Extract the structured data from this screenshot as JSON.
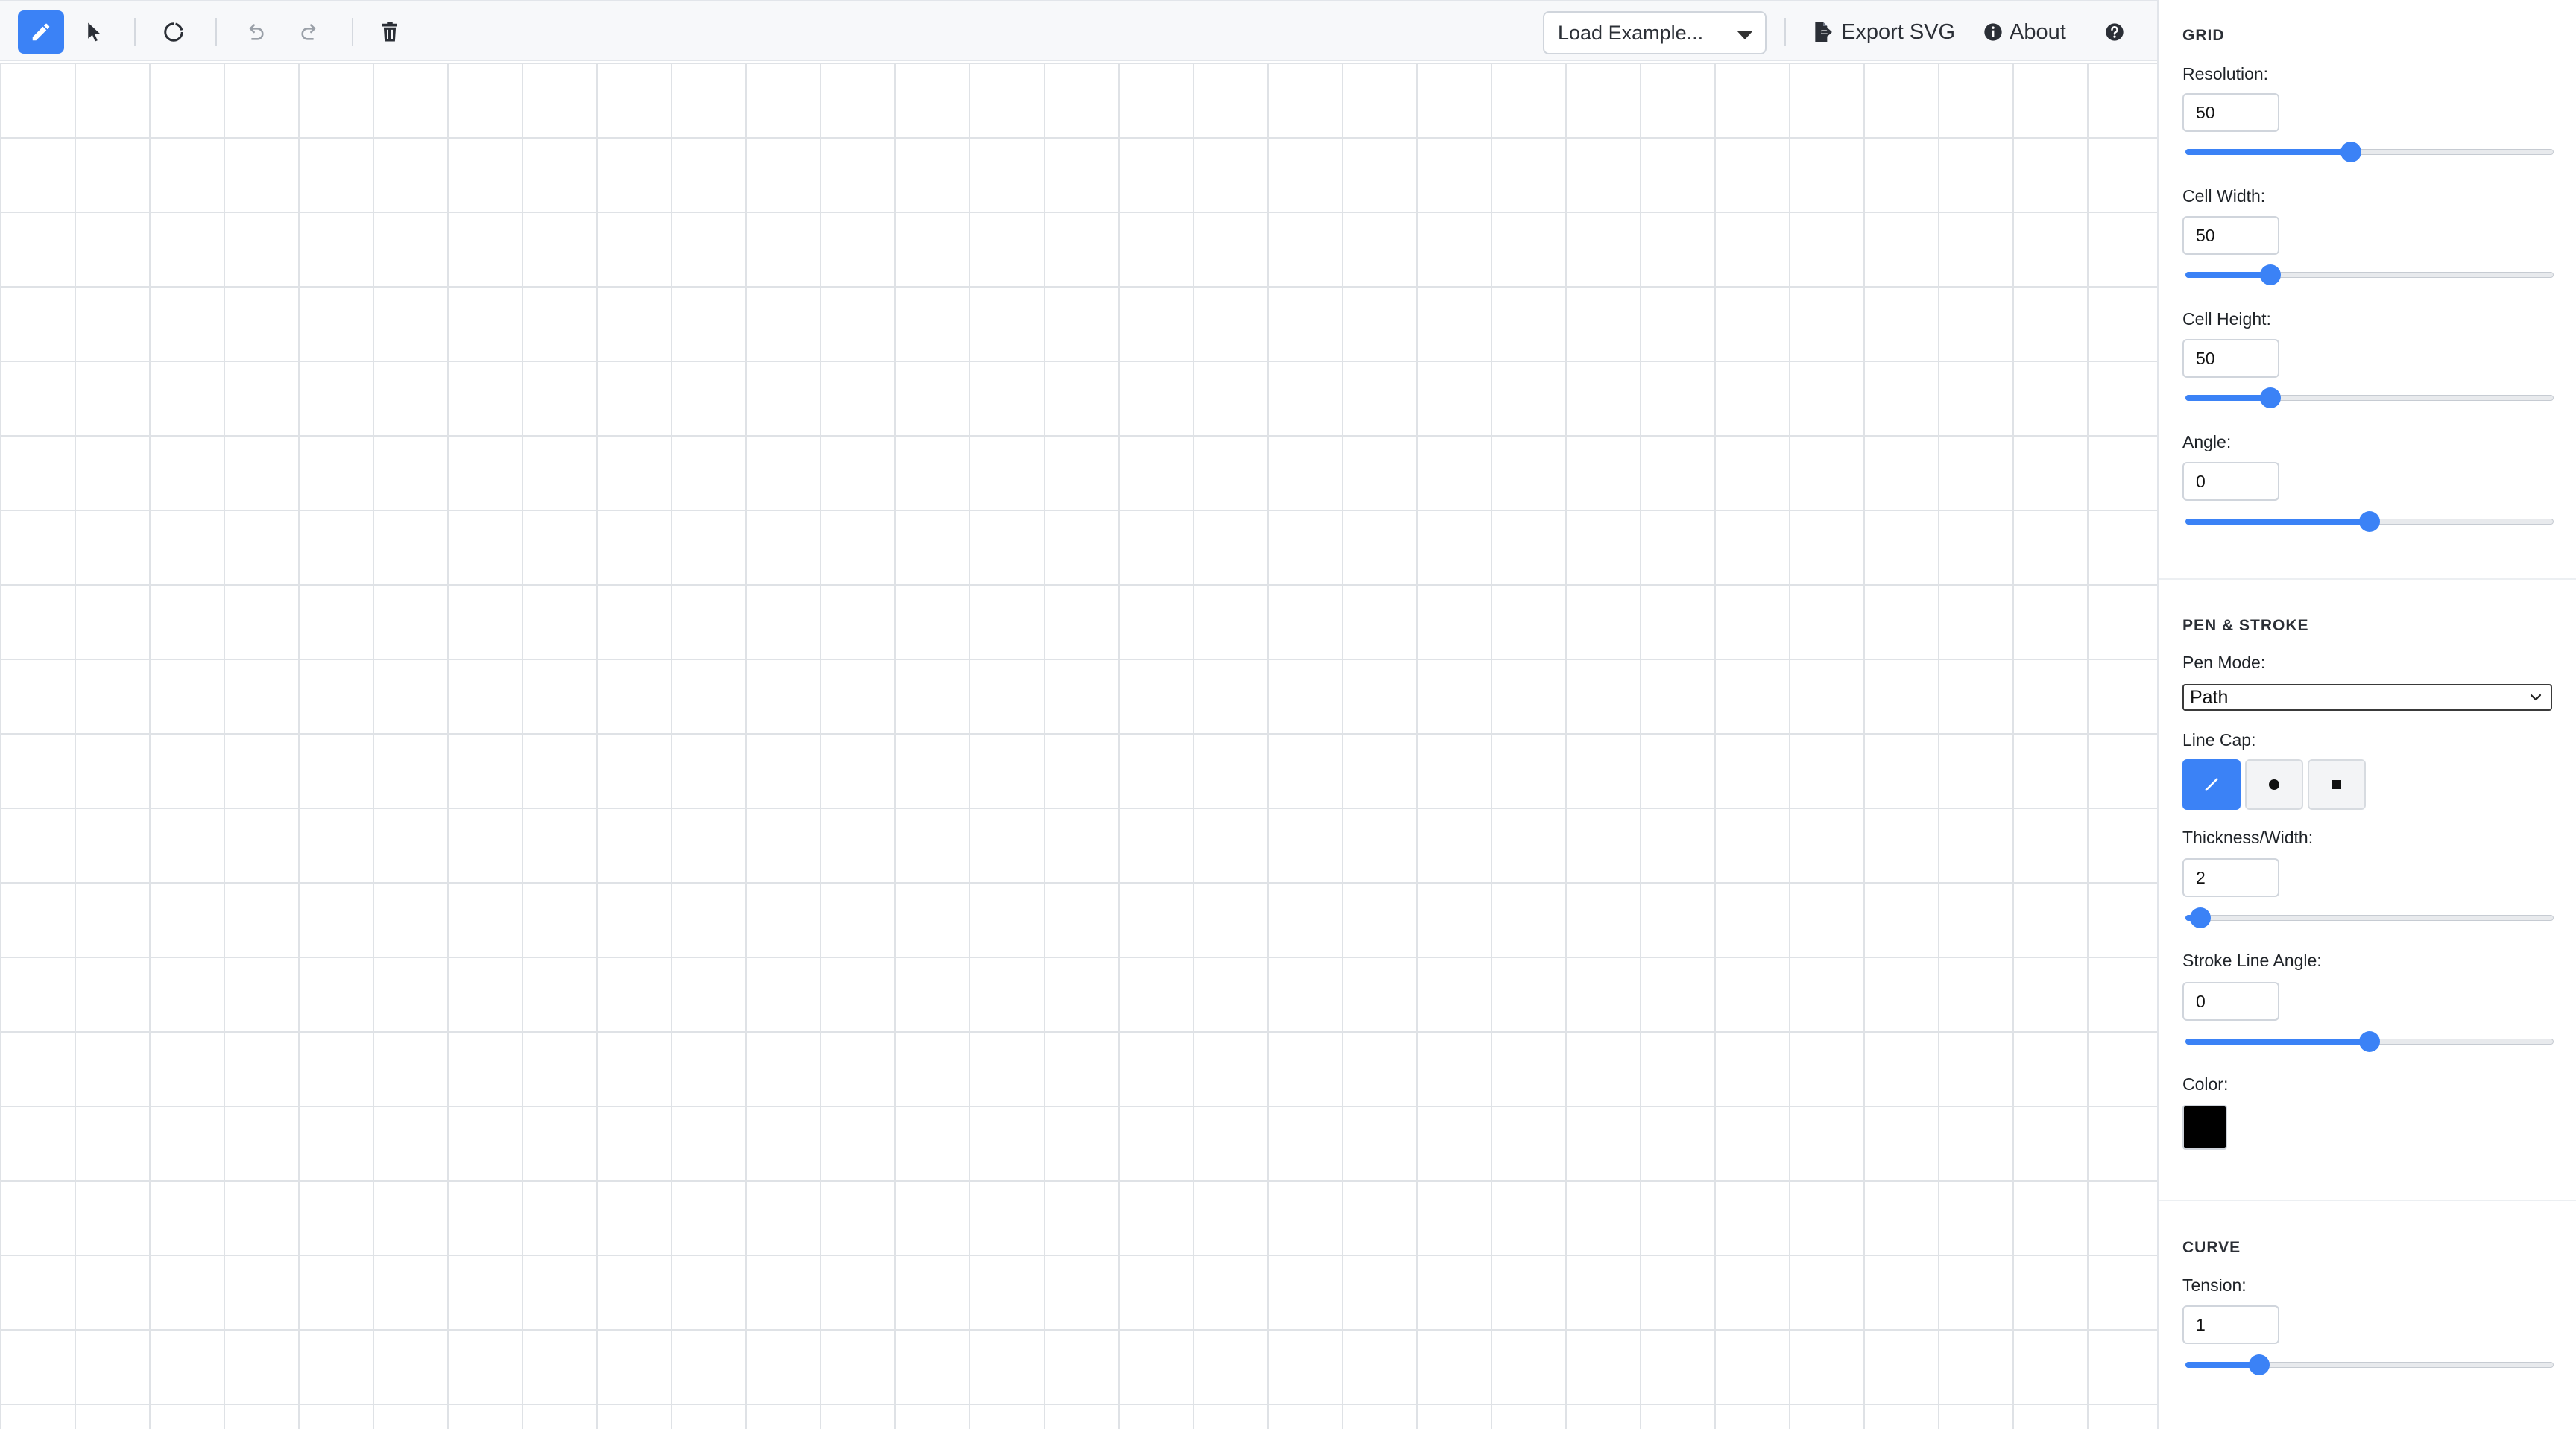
{
  "toolbar": {
    "tools": [
      {
        "name": "pencil-icon",
        "active": true
      },
      {
        "name": "pointer-icon",
        "active": false
      },
      {
        "name": "circle-icon",
        "active": false
      },
      {
        "name": "undo-icon",
        "active": false
      },
      {
        "name": "redo-icon",
        "active": false
      },
      {
        "name": "trash-icon",
        "active": false
      }
    ],
    "load_example_label": "Load Example...",
    "export_label": "Export SVG",
    "about_label": "About",
    "help_icon": "help-icon"
  },
  "sidebar": {
    "grid": {
      "title": "GRID",
      "resolution": {
        "label": "Resolution:",
        "value": "50",
        "level": 0.45
      },
      "cell_width": {
        "label": "Cell Width:",
        "value": "50",
        "level": 0.23
      },
      "cell_height": {
        "label": "Cell Height:",
        "value": "50",
        "level": 0.23
      },
      "angle": {
        "label": "Angle:",
        "value": "0",
        "level": 0.5
      }
    },
    "pen": {
      "title": "PEN & STROKE",
      "pen_mode": {
        "label": "Pen Mode:",
        "value": "Path"
      },
      "line_cap": {
        "label": "Line Cap:",
        "options": [
          "slash-cap-icon",
          "round-cap-icon",
          "square-cap-icon"
        ],
        "selected": 0
      },
      "thickness": {
        "label": "Thickness/Width:",
        "value": "2",
        "level": 0.04
      },
      "stroke_angle": {
        "label": "Stroke Line Angle:",
        "value": "0",
        "level": 0.5
      },
      "color": {
        "label": "Color:",
        "value": "#000000"
      }
    },
    "curve": {
      "title": "CURVE",
      "tension": {
        "label": "Tension:",
        "value": "1",
        "level": 0.2
      }
    }
  },
  "colors": {
    "accent": "#3b82f6",
    "grid_line": "#dfe2e6"
  }
}
